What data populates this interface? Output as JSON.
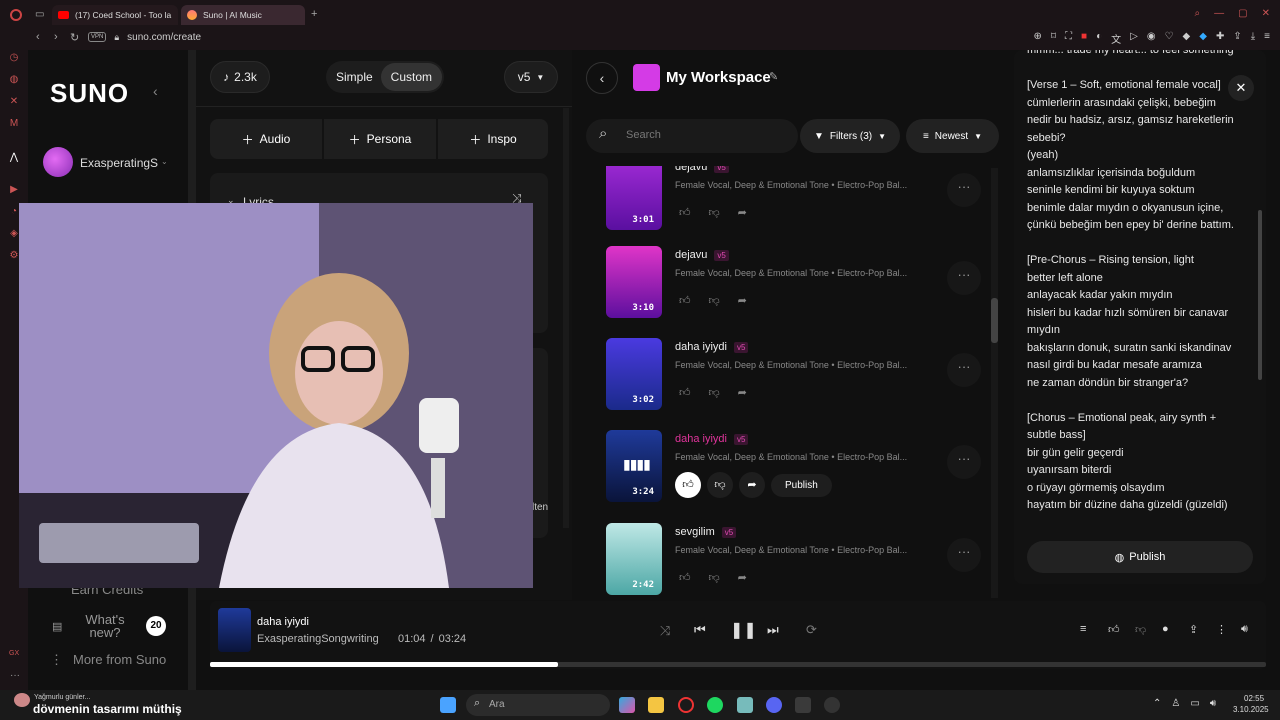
{
  "browser": {
    "tabs": [
      {
        "label": "(17) Coed School - Too la"
      },
      {
        "label": "Suno | AI Music"
      }
    ],
    "new_tab": "+",
    "url": "suno.com/create",
    "vpn": "VPN"
  },
  "sidebar": {
    "logo": "SUNO",
    "user": "ExasperatingSo",
    "items": [
      {
        "label": "Earn Credits"
      },
      {
        "label": "What's new?",
        "badge": "20"
      },
      {
        "label": "More from Suno"
      }
    ]
  },
  "create": {
    "credits": "2.3k",
    "modes": [
      "Simple",
      "Custom"
    ],
    "model": "v5",
    "buttons": [
      "Audio",
      "Persona",
      "Inspo"
    ],
    "lyrics_label": "Lyrics",
    "filter_cut": "lten"
  },
  "workspace": {
    "title": "My Workspace",
    "search_placeholder": "Search",
    "filters": "Filters (3)",
    "sort": "Newest",
    "songs": [
      {
        "title": "dejavu",
        "tag": "v5",
        "desc": "Female Vocal, Deep & Emotional Tone • Electro-Pop Bal...",
        "duration": "3:01"
      },
      {
        "title": "dejavu",
        "tag": "v5",
        "desc": "Female Vocal, Deep & Emotional Tone • Electro-Pop Bal...",
        "duration": "3:10"
      },
      {
        "title": "daha iyiydi",
        "tag": "v5",
        "desc": "Female Vocal, Deep & Emotional Tone • Electro-Pop Bal...",
        "duration": "3:02"
      },
      {
        "title": "daha iyiydi",
        "tag": "v5",
        "desc": "Female Vocal, Deep & Emotional Tone • Electro-Pop Bal...",
        "duration": "3:24",
        "publish": "Publish"
      },
      {
        "title": "sevgilim",
        "tag": "v5",
        "desc": "Female Vocal, Deep & Emotional Tone • Electro-Pop Bal...",
        "duration": "2:42"
      }
    ]
  },
  "lyrics": {
    "text": "mmm... trade my heart... to feel something\n\n[Verse 1 – Soft, emotional female vocal]\ncümlerlerin arasındaki çelişki, bebeğim\nnedir bu hadsiz, arsız, gamsız hareketlerin\nsebebi?\n(yeah)\nanlamsızlıklar içerisinda boğuldum\nseninle kendimi bir kuyuya soktum\nbenimle dalar mıydın o okyanusun içine,\nçünkü bebeğim ben epey bi' derine battım.\n\n[Pre-Chorus – Rising tension, light\nbetter left alone\nanlayacak kadar yakın mıydın\nhisleri bu kadar hızlı sömüren bir canavar\nmıydın\nbakışların donuk, suratın sanki iskandinav\nnasıl girdi bu kadar mesafe aramıza\nne zaman döndün bir stranger'a?\n\n[Chorus – Emotional peak, airy synth +\nsubtle bass]\nbir gün gelir geçerdi\nuyanırsam biterdi\no rüyayı görmemiş olsaydım\nhayatım bir düzine daha güzeldi (güzeldi)",
    "publish": "Publish"
  },
  "player": {
    "title": "daha iyiydi",
    "artist": "ExasperatingSongwriting",
    "elapsed": "01:04",
    "separator": "/",
    "total": "03:24",
    "progress": 0.33
  },
  "taskbar": {
    "weather": "Yağmurlu günler...",
    "caption": "dövmenin tasarımı müthiş",
    "search": "Ara",
    "time": "02:55",
    "date": "3.10.2025"
  },
  "colors": {
    "accent": "#e0349b",
    "bg": "#101010"
  }
}
